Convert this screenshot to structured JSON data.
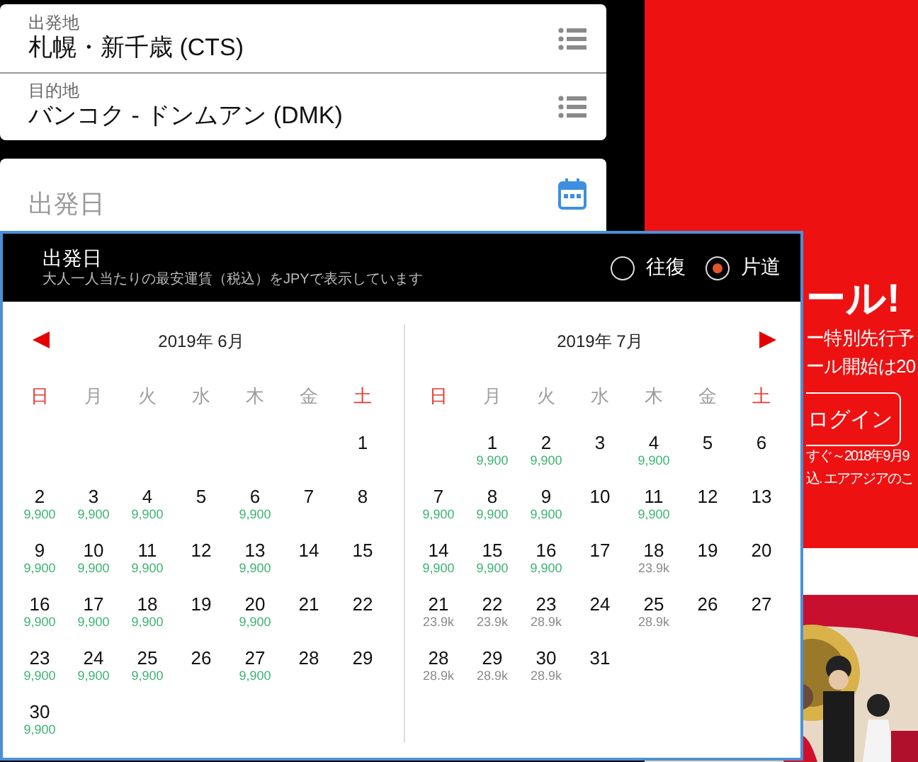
{
  "fields": [
    {
      "label": "出発地",
      "value": "札幌・新千歳 (CTS)"
    },
    {
      "label": "目的地",
      "value": "バンコク - ドンムアン (DMK)"
    }
  ],
  "date_field": {
    "placeholder": "出発日"
  },
  "calendar": {
    "title": "出発日",
    "subtitle": "大人一人当たりの最安運賃（税込）をJPYで表示しています",
    "trip_options": [
      {
        "label": "往復",
        "selected": false
      },
      {
        "label": "片道",
        "selected": true
      }
    ],
    "months": [
      {
        "title": "2019年 6月",
        "kind": "prev",
        "weekdays": [
          {
            "label": "日",
            "color": "#e53935"
          },
          {
            "label": "月",
            "color": "#9e9e9e"
          },
          {
            "label": "火",
            "color": "#9e9e9e"
          },
          {
            "label": "水",
            "color": "#9e9e9e"
          },
          {
            "label": "木",
            "color": "#9e9e9e"
          },
          {
            "label": "金",
            "color": "#9e9e9e"
          },
          {
            "label": "土",
            "color": "#e53935"
          }
        ],
        "weeks": [
          [
            {
              "kind": "blank"
            },
            {
              "kind": "blank"
            },
            {
              "kind": "blank"
            },
            {
              "kind": "blank"
            },
            {
              "kind": "blank"
            },
            {
              "kind": "blank"
            },
            {
              "kind": "day",
              "day": "1"
            }
          ],
          [
            {
              "kind": "day",
              "day": "2",
              "fare": "9,900",
              "color": "#3cb371"
            },
            {
              "kind": "day",
              "day": "3",
              "fare": "9,900",
              "color": "#3cb371"
            },
            {
              "kind": "day",
              "day": "4",
              "fare": "9,900",
              "color": "#3cb371"
            },
            {
              "kind": "day",
              "day": "5"
            },
            {
              "kind": "day",
              "day": "6",
              "fare": "9,900",
              "color": "#3cb371"
            },
            {
              "kind": "day",
              "day": "7"
            },
            {
              "kind": "day",
              "day": "8"
            }
          ],
          [
            {
              "kind": "day",
              "day": "9",
              "fare": "9,900",
              "color": "#3cb371"
            },
            {
              "kind": "day",
              "day": "10",
              "fare": "9,900",
              "color": "#3cb371"
            },
            {
              "kind": "day",
              "day": "11",
              "fare": "9,900",
              "color": "#3cb371"
            },
            {
              "kind": "day",
              "day": "12"
            },
            {
              "kind": "day",
              "day": "13",
              "fare": "9,900",
              "color": "#3cb371"
            },
            {
              "kind": "day",
              "day": "14"
            },
            {
              "kind": "day",
              "day": "15"
            }
          ],
          [
            {
              "kind": "day",
              "day": "16",
              "fare": "9,900",
              "color": "#3cb371"
            },
            {
              "kind": "day",
              "day": "17",
              "fare": "9,900",
              "color": "#3cb371"
            },
            {
              "kind": "day",
              "day": "18",
              "fare": "9,900",
              "color": "#3cb371"
            },
            {
              "kind": "day",
              "day": "19"
            },
            {
              "kind": "day",
              "day": "20",
              "fare": "9,900",
              "color": "#3cb371"
            },
            {
              "kind": "day",
              "day": "21"
            },
            {
              "kind": "day",
              "day": "22"
            }
          ],
          [
            {
              "kind": "day",
              "day": "23",
              "fare": "9,900",
              "color": "#3cb371"
            },
            {
              "kind": "day",
              "day": "24",
              "fare": "9,900",
              "color": "#3cb371"
            },
            {
              "kind": "day",
              "day": "25",
              "fare": "9,900",
              "color": "#3cb371"
            },
            {
              "kind": "day",
              "day": "26"
            },
            {
              "kind": "day",
              "day": "27",
              "fare": "9,900",
              "color": "#3cb371"
            },
            {
              "kind": "day",
              "day": "28"
            },
            {
              "kind": "day",
              "day": "29"
            }
          ],
          [
            {
              "kind": "day",
              "day": "30",
              "fare": "9,900",
              "color": "#3cb371"
            },
            {
              "kind": "blank"
            },
            {
              "kind": "blank"
            },
            {
              "kind": "blank"
            },
            {
              "kind": "blank"
            },
            {
              "kind": "blank"
            },
            {
              "kind": "blank"
            }
          ]
        ]
      },
      {
        "title": "2019年 7月",
        "kind": "next",
        "weekdays": [
          {
            "label": "日",
            "color": "#e53935"
          },
          {
            "label": "月",
            "color": "#9e9e9e"
          },
          {
            "label": "火",
            "color": "#9e9e9e"
          },
          {
            "label": "水",
            "color": "#9e9e9e"
          },
          {
            "label": "木",
            "color": "#9e9e9e"
          },
          {
            "label": "金",
            "color": "#9e9e9e"
          },
          {
            "label": "土",
            "color": "#e53935"
          }
        ],
        "weeks": [
          [
            {
              "kind": "blank"
            },
            {
              "kind": "day",
              "day": "1",
              "fare": "9,900",
              "color": "#3cb371"
            },
            {
              "kind": "day",
              "day": "2",
              "fare": "9,900",
              "color": "#3cb371"
            },
            {
              "kind": "day",
              "day": "3"
            },
            {
              "kind": "day",
              "day": "4",
              "fare": "9,900",
              "color": "#3cb371"
            },
            {
              "kind": "day",
              "day": "5"
            },
            {
              "kind": "day",
              "day": "6"
            }
          ],
          [
            {
              "kind": "day",
              "day": "7",
              "fare": "9,900",
              "color": "#3cb371"
            },
            {
              "kind": "day",
              "day": "8",
              "fare": "9,900",
              "color": "#3cb371"
            },
            {
              "kind": "day",
              "day": "9",
              "fare": "9,900",
              "color": "#3cb371"
            },
            {
              "kind": "day",
              "day": "10"
            },
            {
              "kind": "day",
              "day": "11",
              "fare": "9,900",
              "color": "#3cb371"
            },
            {
              "kind": "day",
              "day": "12"
            },
            {
              "kind": "day",
              "day": "13"
            }
          ],
          [
            {
              "kind": "day",
              "day": "14",
              "fare": "9,900",
              "color": "#3cb371"
            },
            {
              "kind": "day",
              "day": "15",
              "fare": "9,900",
              "color": "#3cb371"
            },
            {
              "kind": "day",
              "day": "16",
              "fare": "9,900",
              "color": "#3cb371"
            },
            {
              "kind": "day",
              "day": "17"
            },
            {
              "kind": "day",
              "day": "18",
              "fare": "23.9k",
              "color": "#8a8a8a"
            },
            {
              "kind": "day",
              "day": "19"
            },
            {
              "kind": "day",
              "day": "20"
            }
          ],
          [
            {
              "kind": "day",
              "day": "21",
              "fare": "23.9k",
              "color": "#8a8a8a"
            },
            {
              "kind": "day",
              "day": "22",
              "fare": "23.9k",
              "color": "#8a8a8a"
            },
            {
              "kind": "day",
              "day": "23",
              "fare": "28.9k",
              "color": "#8a8a8a"
            },
            {
              "kind": "day",
              "day": "24"
            },
            {
              "kind": "day",
              "day": "25",
              "fare": "28.9k",
              "color": "#8a8a8a"
            },
            {
              "kind": "day",
              "day": "26"
            },
            {
              "kind": "day",
              "day": "27"
            }
          ],
          [
            {
              "kind": "day",
              "day": "28",
              "fare": "28.9k",
              "color": "#8a8a8a"
            },
            {
              "kind": "day",
              "day": "29",
              "fare": "28.9k",
              "color": "#8a8a8a"
            },
            {
              "kind": "day",
              "day": "30",
              "fare": "28.9k",
              "color": "#8a8a8a"
            },
            {
              "kind": "day",
              "day": "31"
            },
            {
              "kind": "blank"
            },
            {
              "kind": "blank"
            },
            {
              "kind": "blank"
            }
          ]
        ]
      }
    ]
  },
  "banner": {
    "headline": "ール!",
    "lines": [
      "ー特別先行予",
      "ール開始は20"
    ],
    "button": "ログイン",
    "notes": [
      "すぐ～2018年9月9",
      "込. エアアジアのこ"
    ]
  }
}
